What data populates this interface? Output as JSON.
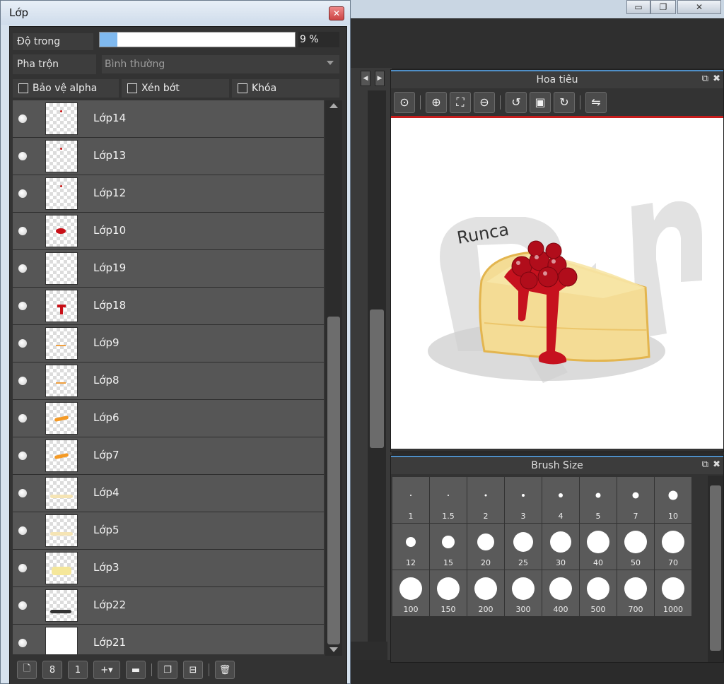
{
  "window_controls": {
    "minimize": "▭",
    "restore": "❐",
    "close": "✕"
  },
  "layer_window": {
    "title": "Lớp",
    "opacity_label": "Độ trong",
    "opacity_value": "9 %",
    "opacity_fraction": 0.09,
    "blend_label": "Pha trộn",
    "blend_value": "Bình thường",
    "checkboxes": [
      "Bảo vệ alpha",
      "Xén bớt",
      "Khóa"
    ],
    "layers": [
      {
        "name": "Lớp14",
        "thumb": "dot-red"
      },
      {
        "name": "Lớp13",
        "thumb": "dot-red"
      },
      {
        "name": "Lớp12",
        "thumb": "dot-red"
      },
      {
        "name": "Lớp10",
        "thumb": "blob-red"
      },
      {
        "name": "Lớp19",
        "thumb": "empty"
      },
      {
        "name": "Lớp18",
        "thumb": "drip-red"
      },
      {
        "name": "Lớp9",
        "thumb": "dash-orange"
      },
      {
        "name": "Lớp8",
        "thumb": "dash-orange"
      },
      {
        "name": "Lớp6",
        "thumb": "stroke-orange"
      },
      {
        "name": "Lớp7",
        "thumb": "stroke-orange"
      },
      {
        "name": "Lớp4",
        "thumb": "faint-yellow"
      },
      {
        "name": "Lớp5",
        "thumb": "faint-yellow"
      },
      {
        "name": "Lớp3",
        "thumb": "yellow"
      },
      {
        "name": "Lớp22",
        "thumb": "shadow-dark"
      },
      {
        "name": "Lớp21",
        "thumb": "solid-white"
      }
    ],
    "footer_buttons": [
      "new-layer-icon",
      "new-8bit-layer-icon",
      "new-1bit-layer-icon",
      "add-layer-menu-icon",
      "folder-icon",
      "duplicate-icon",
      "merge-down-icon",
      "trash-icon"
    ]
  },
  "navigator": {
    "title": "Hoa tiêu",
    "tools": [
      "zoom-reset-icon",
      "zoom-in-icon",
      "fit-window-icon",
      "zoom-out-icon",
      "rotate-left-icon",
      "rotate-reset-icon",
      "rotate-right-icon",
      "flip-icon"
    ],
    "preview_text": "Runca"
  },
  "brush_size": {
    "title": "Brush Size",
    "sizes": [
      "1",
      "1.5",
      "2",
      "3",
      "4",
      "5",
      "7",
      "10",
      "12",
      "15",
      "20",
      "25",
      "30",
      "40",
      "50",
      "70",
      "100",
      "150",
      "200",
      "300",
      "400",
      "500",
      "700",
      "1000"
    ]
  },
  "colors": {
    "accent": "#4f8fc8",
    "highlight": "#c61c1c",
    "panel": "#333333"
  }
}
